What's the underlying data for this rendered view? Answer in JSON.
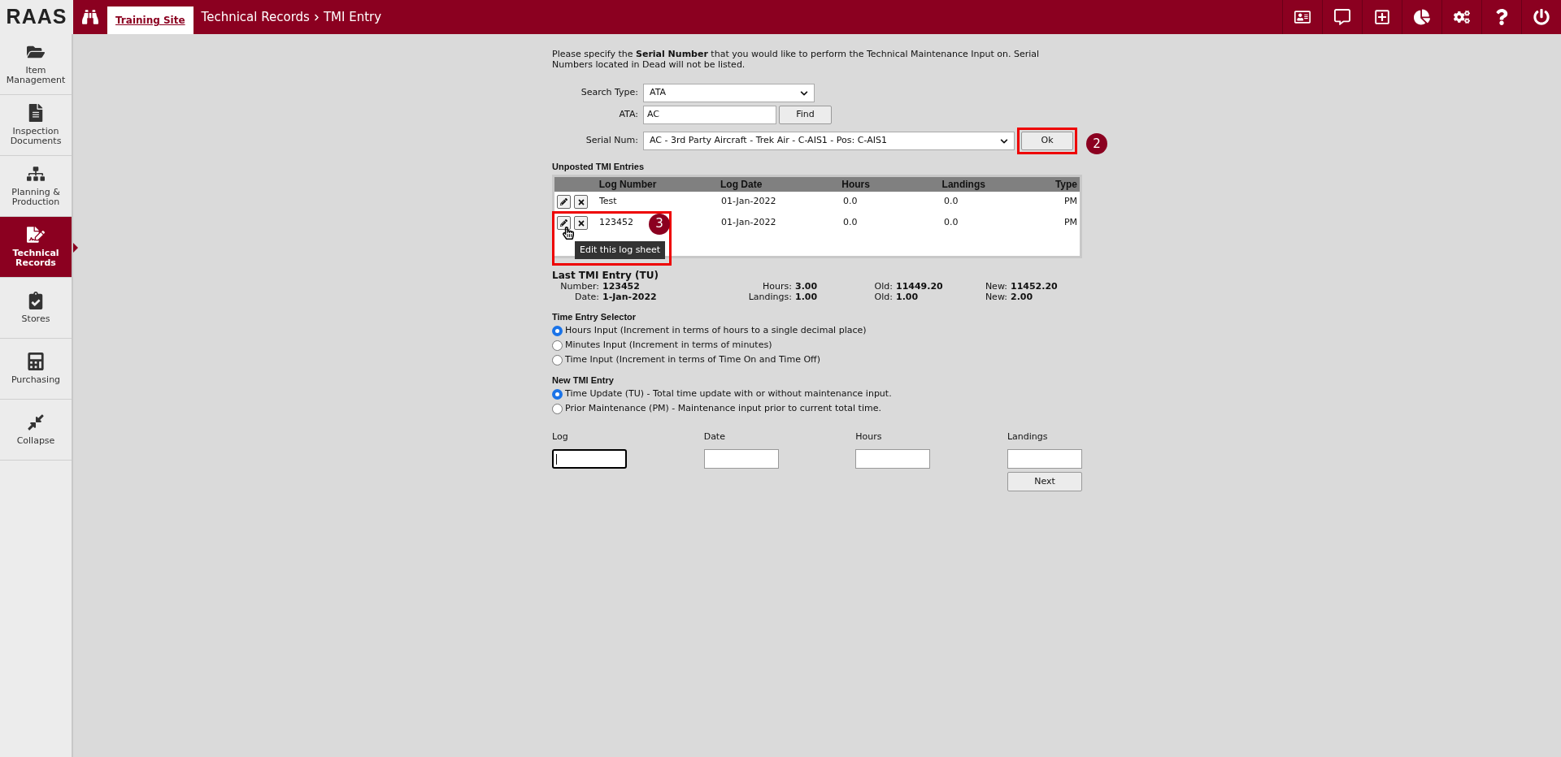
{
  "header": {
    "logo": "RAAS",
    "site_tab": "Training Site",
    "breadcrumb": [
      "Technical Records",
      "TMI Entry"
    ]
  },
  "sidebar": {
    "items": [
      {
        "label": "Item Management",
        "selected": false
      },
      {
        "label": "Inspection Documents",
        "selected": false
      },
      {
        "label": "Planning & Production",
        "selected": false
      },
      {
        "label": "Technical Records",
        "selected": true
      },
      {
        "label": "Stores",
        "selected": false
      },
      {
        "label": "Purchasing",
        "selected": false
      },
      {
        "label": "Collapse",
        "selected": false
      }
    ]
  },
  "intro": "Please specify the **Serial Number** that you would like to perform the Technical Maintenance Input on. Serial Numbers located in Dead will not be listed.",
  "form": {
    "search_type": {
      "label": "Search Type:",
      "value": "ATA"
    },
    "ata": {
      "label": "ATA:",
      "value": "AC",
      "button": "Find"
    },
    "serial_num": {
      "label": "Serial Num:",
      "value": "AC - 3rd Party Aircraft - Trek Air - C-AIS1 - Pos: C-AIS1",
      "button": "Ok"
    }
  },
  "annotations": [
    "2",
    "3"
  ],
  "unposted": {
    "title": "Unposted TMI Entries",
    "columns": [
      "Log Number",
      "Log Date",
      "Hours",
      "Landings",
      "Type"
    ],
    "rows": [
      [
        "Test",
        "01-Jan-2022",
        "0.0",
        "0.0",
        "PM"
      ],
      [
        "123452",
        "01-Jan-2022",
        "0.0",
        "0.0",
        "PM"
      ]
    ],
    "tooltip": "Edit this log sheet"
  },
  "last_entry": {
    "title": "Last TMI Entry (TU)",
    "rows": [
      [
        [
          "Number:",
          "123452"
        ],
        [
          "Hours:",
          "3.00"
        ],
        [
          "Old:",
          "11449.20"
        ],
        [
          "New:",
          "11452.20"
        ]
      ],
      [
        [
          "Date:",
          "1-Jan-2022"
        ],
        [
          "Landings:",
          "1.00"
        ],
        [
          "Old:",
          "1.00"
        ],
        [
          "New:",
          "2.00"
        ]
      ]
    ]
  },
  "time_entry_selector": {
    "title": "Time Entry Selector",
    "options": [
      {
        "label": "Hours Input (Increment in terms of hours to a single decimal place)",
        "selected": true
      },
      {
        "label": "Minutes Input (Increment in terms of minutes)",
        "selected": false
      },
      {
        "label": "Time Input (Increment in terms of Time On and Time Off)",
        "selected": false
      }
    ]
  },
  "new_tmi_entry": {
    "title": "New TMI Entry",
    "options": [
      {
        "label": "Time Update (TU) - Total time update with or without maintenance input.",
        "selected": true
      },
      {
        "label": "Prior Maintenance (PM) - Maintenance input prior to current total time.",
        "selected": false
      }
    ]
  },
  "entry_fields": [
    {
      "label": "Log",
      "focused": true
    },
    {
      "label": "Date",
      "focused": false
    },
    {
      "label": "Hours",
      "focused": false
    },
    {
      "label": "Landings",
      "focused": false
    }
  ],
  "next_button": "Next"
}
